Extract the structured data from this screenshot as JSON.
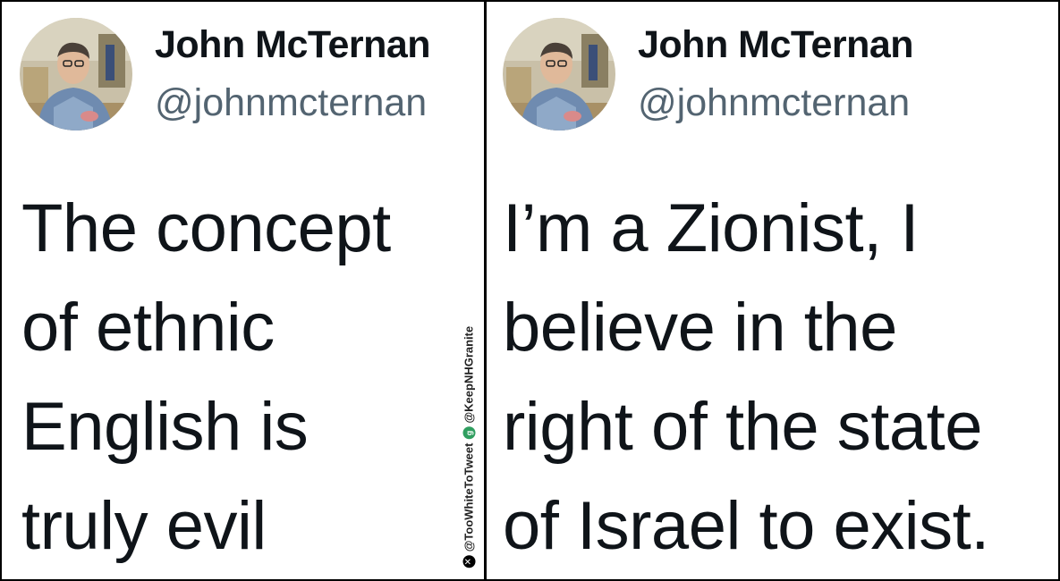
{
  "tweets": [
    {
      "author_name": "John McTernan",
      "author_handle": "@johnmcternan",
      "lines": [
        "The concept",
        "of ethnic",
        "English is",
        "truly evil"
      ]
    },
    {
      "author_name": "John McTernan",
      "author_handle": "@johnmcternan",
      "lines": [
        "I’m a Zionist, I",
        "believe in the",
        "right of the state",
        "of Israel to exist."
      ]
    }
  ],
  "watermark": {
    "handle_x": "@TooWhiteToTweet",
    "handle_gab": "@KeepNHGranite",
    "icon_x": "x-logo-icon",
    "icon_gab": "gab-logo-icon"
  },
  "colors": {
    "text": "#0f1419",
    "handle": "#536471",
    "border": "#000000"
  }
}
